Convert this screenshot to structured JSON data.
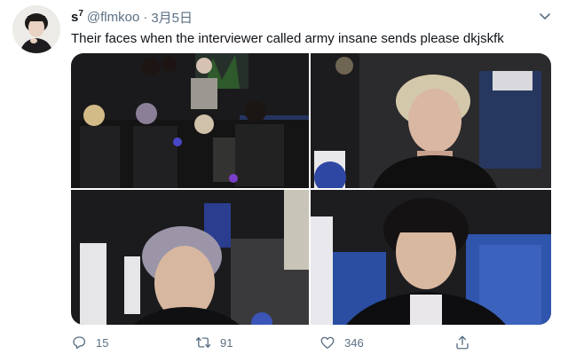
{
  "tweet": {
    "author_name": "s",
    "author_sup": "7",
    "handle": "@flmkoo",
    "separator": "·",
    "date": "3月5日",
    "text": "Their faces when the interviewer called army insane sends please dkjskfk"
  },
  "actions": {
    "reply_count": "15",
    "retweet_count": "91",
    "like_count": "346"
  },
  "colors": {
    "secondary_text": "#5b7083",
    "primary_text": "#0f1419"
  },
  "icons": {
    "more": "chevron-down-icon",
    "reply": "reply-icon",
    "retweet": "retweet-icon",
    "like": "heart-icon",
    "share": "share-icon"
  }
}
